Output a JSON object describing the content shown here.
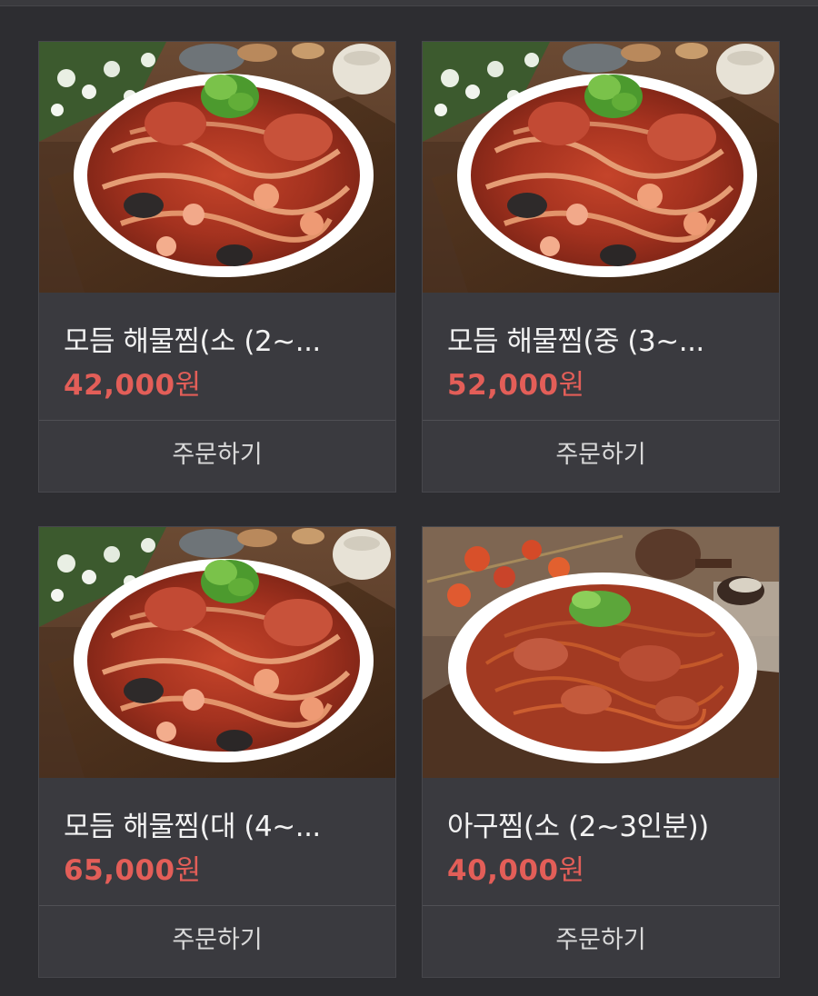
{
  "menu": {
    "items": [
      {
        "name": "모듬 해물찜(소 (2~...",
        "price": "42,000",
        "currency": "원",
        "order_label": "주문하기",
        "image": "seafood-jjim-photo"
      },
      {
        "name": "모듬 해물찜(중 (3~...",
        "price": "52,000",
        "currency": "원",
        "order_label": "주문하기",
        "image": "seafood-jjim-photo"
      },
      {
        "name": "모듬 해물찜(대 (4~...",
        "price": "65,000",
        "currency": "원",
        "order_label": "주문하기",
        "image": "seafood-jjim-photo"
      },
      {
        "name": "아구찜(소 (2~3인분))",
        "price": "40,000",
        "currency": "원",
        "order_label": "주문하기",
        "image": "agujjim-photo"
      }
    ]
  },
  "colors": {
    "background": "#2d2d31",
    "card": "#3a3a3f",
    "price": "#e35e58",
    "text": "#f2f2f2"
  }
}
